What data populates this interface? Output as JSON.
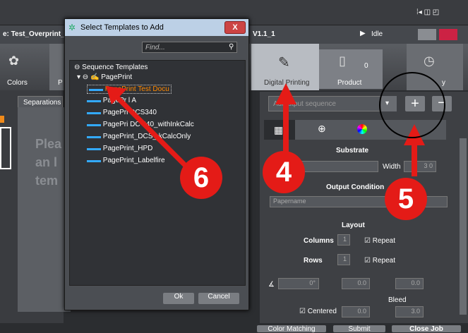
{
  "app": {
    "window_controls": "⁞◂ ◫ ◰",
    "job_title_prefix": "e: Test_Overprint_",
    "job_suffix": "V1.1_1",
    "status": "Idle",
    "left_tools": [
      {
        "label": "Colors",
        "icon": "palette-icon"
      },
      {
        "label": "P",
        "icon": "p-icon"
      }
    ],
    "workflow": [
      {
        "label": "Digital Printing"
      },
      {
        "label": "Product",
        "count": "0"
      }
    ],
    "right_tool_suffix": "y"
  },
  "left": {
    "tab": "Separations",
    "watermark": [
      "Plea",
      "an l",
      "tem"
    ]
  },
  "dialog": {
    "title": "Select Templates to Add",
    "close": "X",
    "search_placeholder": "Find...",
    "tree_root": "Sequence Templates",
    "group": "PagePrint",
    "items": [
      "PagePrint Test Docu",
      "PagePr  l A",
      "PagePri  DCS340",
      "PagePri  DC  340_withInkCalc",
      "PagePrint_DCS_  kCalcOnly",
      "PagePrint_HPD",
      "PagePrint_Labelfire"
    ],
    "ok": "Ok",
    "cancel": "Cancel"
  },
  "right": {
    "sequence_placeholder": "Add   utput sequence",
    "add_label": "+",
    "remove_label": "−",
    "substrate": "Substrate",
    "substrate_value": "  e0",
    "width_label": "Width",
    "width_value": "3   0",
    "output_condition": "Output Condition",
    "papername": "         Papername",
    "layout": "Layout",
    "columns": "Columns",
    "columns_value": "1",
    "rows": "Rows",
    "rows_value": "1",
    "repeat": "Repeat",
    "angle_value": "0°",
    "offset_value": "0.0",
    "spacing_value": "0.0",
    "bleed": "Bleed",
    "centered": "Centered",
    "centered_value": "0.0",
    "bleed_value": "3.0"
  },
  "bottom": {
    "buttons": [
      "Color Matching",
      "Submit",
      "Close Job"
    ]
  },
  "callouts": [
    "6",
    "4",
    "5"
  ]
}
